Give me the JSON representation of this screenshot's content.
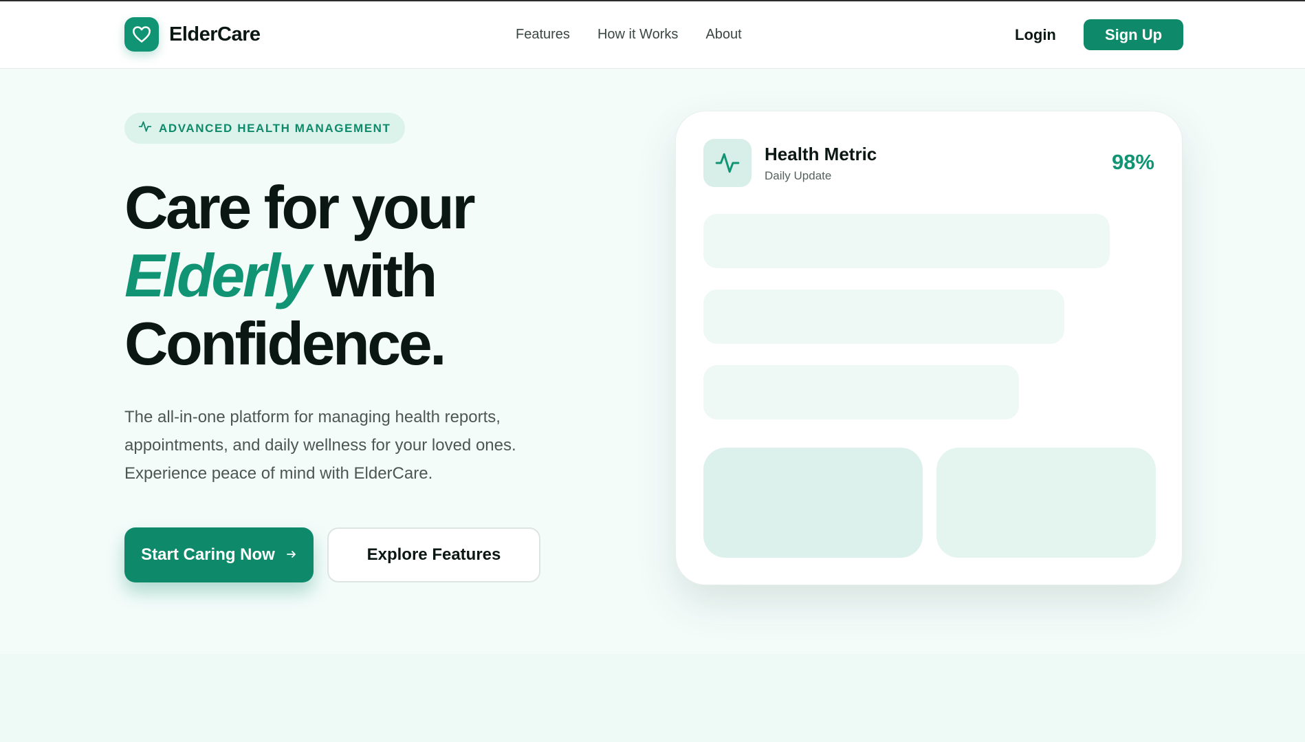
{
  "brand": {
    "name": "ElderCare",
    "logo_icon": "heart-icon"
  },
  "nav": {
    "items": [
      "Features",
      "How it Works",
      "About"
    ]
  },
  "auth": {
    "login_label": "Login",
    "signup_label": "Sign Up"
  },
  "hero": {
    "badge": {
      "icon": "pulse-icon",
      "text": "ADVANCED HEALTH MANAGEMENT"
    },
    "headline": {
      "line1": "Care for your",
      "accent": "Elderly",
      "line2_rest": "with",
      "line3": "Confidence."
    },
    "subtext": "The all-in-one platform for managing health reports, appointments, and daily wellness for your loved ones. Experience peace of mind with ElderCare.",
    "primary_cta": {
      "label": "Start Caring Now",
      "icon": "arrow-right-icon"
    },
    "secondary_cta": {
      "label": "Explore Features"
    }
  },
  "card": {
    "icon": "pulse-icon",
    "title": "Health Metric",
    "subtitle": "Daily Update",
    "value": "98%"
  },
  "colors": {
    "accent": "#119474",
    "accent_dark": "#0e8a6b",
    "page_bg": "#f4fcfa",
    "text": "#0b1713"
  }
}
